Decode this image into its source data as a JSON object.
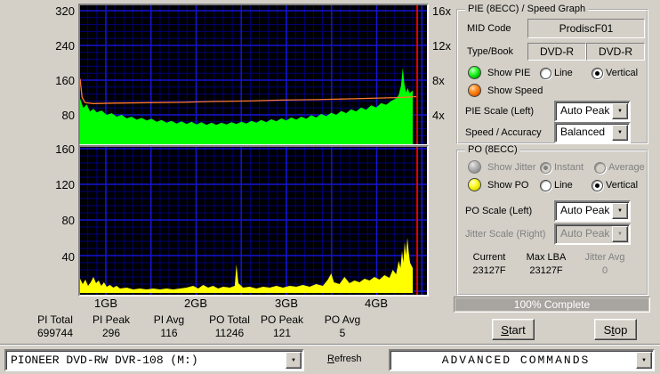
{
  "chart_data": {
    "xticks": [
      "1GB",
      "2GB",
      "3GB",
      "4GB"
    ],
    "pie": {
      "type": "area",
      "title": "PIE (8ECC) / Speed Graph",
      "ylim": [
        0,
        320
      ],
      "yticks": [
        "320",
        "240",
        "160",
        "80"
      ],
      "speed_ticks": [
        "16x",
        "12x",
        "8x",
        "4x"
      ],
      "grid": {
        "minor_color": "#000078",
        "major_color": "#1414d2",
        "bg": "#000000"
      },
      "pie_series": {
        "name": "PIE",
        "color": "#00ff00",
        "points": [
          [
            0,
            118
          ],
          [
            0.01,
            96
          ],
          [
            0.02,
            104
          ],
          [
            0.03,
            88
          ],
          [
            0.04,
            94
          ],
          [
            0.05,
            86
          ],
          [
            0.065,
            90
          ],
          [
            0.08,
            80
          ],
          [
            0.095,
            84
          ],
          [
            0.11,
            76
          ],
          [
            0.125,
            80
          ],
          [
            0.14,
            72
          ],
          [
            0.155,
            76
          ],
          [
            0.17,
            69
          ],
          [
            0.185,
            73
          ],
          [
            0.2,
            67
          ],
          [
            0.215,
            71
          ],
          [
            0.23,
            64
          ],
          [
            0.245,
            68
          ],
          [
            0.26,
            62
          ],
          [
            0.275,
            66
          ],
          [
            0.29,
            60
          ],
          [
            0.305,
            65
          ],
          [
            0.32,
            59
          ],
          [
            0.335,
            64
          ],
          [
            0.35,
            58
          ],
          [
            0.365,
            63
          ],
          [
            0.38,
            57
          ],
          [
            0.395,
            62
          ],
          [
            0.41,
            57
          ],
          [
            0.425,
            62
          ],
          [
            0.44,
            58
          ],
          [
            0.455,
            63
          ],
          [
            0.47,
            59
          ],
          [
            0.485,
            64
          ],
          [
            0.5,
            60
          ],
          [
            0.515,
            66
          ],
          [
            0.53,
            62
          ],
          [
            0.545,
            68
          ],
          [
            0.56,
            63
          ],
          [
            0.575,
            70
          ],
          [
            0.59,
            65
          ],
          [
            0.605,
            72
          ],
          [
            0.62,
            67
          ],
          [
            0.635,
            74
          ],
          [
            0.65,
            69
          ],
          [
            0.665,
            76
          ],
          [
            0.68,
            71
          ],
          [
            0.695,
            79
          ],
          [
            0.71,
            74
          ],
          [
            0.725,
            82
          ],
          [
            0.74,
            77
          ],
          [
            0.755,
            85
          ],
          [
            0.77,
            80
          ],
          [
            0.785,
            89
          ],
          [
            0.8,
            84
          ],
          [
            0.815,
            93
          ],
          [
            0.83,
            88
          ],
          [
            0.845,
            97
          ],
          [
            0.86,
            92
          ],
          [
            0.875,
            102
          ],
          [
            0.89,
            97
          ],
          [
            0.905,
            107
          ],
          [
            0.92,
            103
          ],
          [
            0.935,
            112
          ],
          [
            0.95,
            118
          ],
          [
            0.958,
            126
          ],
          [
            0.965,
            148
          ],
          [
            0.97,
            188
          ],
          [
            0.975,
            152
          ],
          [
            0.98,
            132
          ],
          [
            0.985,
            142
          ],
          [
            0.99,
            130
          ],
          [
            1,
            136
          ]
        ]
      },
      "speed_series": {
        "name": "Speed",
        "color": "#ff7a30",
        "points": [
          [
            0,
            163
          ],
          [
            0.006,
            120
          ],
          [
            0.015,
            108
          ],
          [
            0.04,
            106
          ],
          [
            0.1,
            107
          ],
          [
            0.2,
            108
          ],
          [
            0.3,
            109
          ],
          [
            0.4,
            111
          ],
          [
            0.5,
            112
          ],
          [
            0.6,
            114
          ],
          [
            0.7,
            115
          ],
          [
            0.8,
            117
          ],
          [
            0.9,
            119
          ],
          [
            0.95,
            120
          ],
          [
            1,
            122
          ]
        ]
      },
      "marker_color": "#dd0000"
    },
    "po": {
      "type": "area",
      "title": "PO (8ECC)",
      "ylim": [
        0,
        160
      ],
      "yticks": [
        "160",
        "120",
        "80",
        "40"
      ],
      "grid": {
        "minor_color": "#000078",
        "major_color": "#1414d2",
        "bg": "#000000"
      },
      "po_series": {
        "name": "PO",
        "color": "#ffff00",
        "points": [
          [
            0,
            14
          ],
          [
            0.008,
            8
          ],
          [
            0.016,
            13
          ],
          [
            0.024,
            6
          ],
          [
            0.032,
            10
          ],
          [
            0.04,
            16
          ],
          [
            0.048,
            9
          ],
          [
            0.056,
            12
          ],
          [
            0.064,
            6
          ],
          [
            0.072,
            10
          ],
          [
            0.08,
            5
          ],
          [
            0.09,
            7
          ],
          [
            0.1,
            4
          ],
          [
            0.11,
            6
          ],
          [
            0.12,
            3
          ],
          [
            0.14,
            4
          ],
          [
            0.16,
            2
          ],
          [
            0.18,
            3
          ],
          [
            0.2,
            2
          ],
          [
            0.22,
            3
          ],
          [
            0.24,
            2
          ],
          [
            0.26,
            3
          ],
          [
            0.28,
            2
          ],
          [
            0.3,
            3
          ],
          [
            0.32,
            4
          ],
          [
            0.34,
            6
          ],
          [
            0.355,
            3
          ],
          [
            0.37,
            7
          ],
          [
            0.385,
            4
          ],
          [
            0.4,
            6
          ],
          [
            0.415,
            3
          ],
          [
            0.43,
            5
          ],
          [
            0.45,
            4
          ],
          [
            0.465,
            6
          ],
          [
            0.47,
            30
          ],
          [
            0.476,
            9
          ],
          [
            0.49,
            4
          ],
          [
            0.51,
            5
          ],
          [
            0.53,
            3
          ],
          [
            0.55,
            5
          ],
          [
            0.57,
            4
          ],
          [
            0.59,
            6
          ],
          [
            0.61,
            4
          ],
          [
            0.63,
            6
          ],
          [
            0.65,
            5
          ],
          [
            0.67,
            7
          ],
          [
            0.69,
            5
          ],
          [
            0.71,
            8
          ],
          [
            0.73,
            6
          ],
          [
            0.745,
            13
          ],
          [
            0.755,
            20
          ],
          [
            0.763,
            10
          ],
          [
            0.78,
            8
          ],
          [
            0.795,
            16
          ],
          [
            0.81,
            9
          ],
          [
            0.825,
            12
          ],
          [
            0.84,
            10
          ],
          [
            0.855,
            14
          ],
          [
            0.87,
            12
          ],
          [
            0.885,
            16
          ],
          [
            0.9,
            13
          ],
          [
            0.915,
            18
          ],
          [
            0.93,
            15
          ],
          [
            0.94,
            24
          ],
          [
            0.95,
            19
          ],
          [
            0.958,
            34
          ],
          [
            0.963,
            26
          ],
          [
            0.968,
            45
          ],
          [
            0.972,
            32
          ],
          [
            0.976,
            55
          ],
          [
            0.98,
            40
          ],
          [
            0.984,
            60
          ],
          [
            0.988,
            44
          ],
          [
            0.992,
            32
          ],
          [
            1,
            26
          ]
        ]
      },
      "marker_color": "#dd0000"
    }
  },
  "pie_group": {
    "title": "PIE (8ECC) / Speed Graph",
    "mid_code_label": "MID Code",
    "mid_code_value": "ProdiscF01",
    "type_book_label": "Type/Book",
    "type_value_1": "DVD-R",
    "type_value_2": "DVD-R",
    "show_pie_label": "Show PIE",
    "line_label": "Line",
    "vertical_label": "Vertical",
    "show_speed_label": "Show Speed",
    "pie_scale_label": "PIE Scale (Left)",
    "pie_scale_value": "Auto Peak",
    "speed_accuracy_label": "Speed / Accuracy",
    "speed_accuracy_value": "Balanced"
  },
  "po_group": {
    "title": "PO (8ECC)",
    "show_jitter_label": "Show Jitter",
    "instant_label": "Instant",
    "average_label": "Average",
    "show_po_label": "Show PO",
    "line_label": "Line",
    "vertical_label": "Vertical",
    "po_scale_label": "PO Scale (Left)",
    "po_scale_value": "Auto Peak",
    "jitter_scale_label": "Jitter Scale (Right)",
    "jitter_scale_value": "Auto Peak",
    "current_label": "Current",
    "current_value": "23127F",
    "max_lba_label": "Max LBA",
    "max_lba_value": "23127F",
    "jitter_avg_label": "Jitter Avg",
    "jitter_avg_value": "0"
  },
  "progress": {
    "text": "100% Complete"
  },
  "buttons": {
    "start": "Start",
    "stop": "Stop"
  },
  "stats": [
    {
      "label": "PI Total",
      "value": "699744"
    },
    {
      "label": "PI Peak",
      "value": "296"
    },
    {
      "label": "PI Avg",
      "value": "116"
    },
    {
      "label": "PO Total",
      "value": "11246"
    },
    {
      "label": "PO Peak",
      "value": "121"
    },
    {
      "label": "PO Avg",
      "value": "5"
    }
  ],
  "bottom_bar": {
    "drive_value": "PIONEER DVD-RW  DVR-108  (M:)",
    "refresh_label": "Refresh",
    "advanced_value": "ADVANCED COMMANDS"
  }
}
